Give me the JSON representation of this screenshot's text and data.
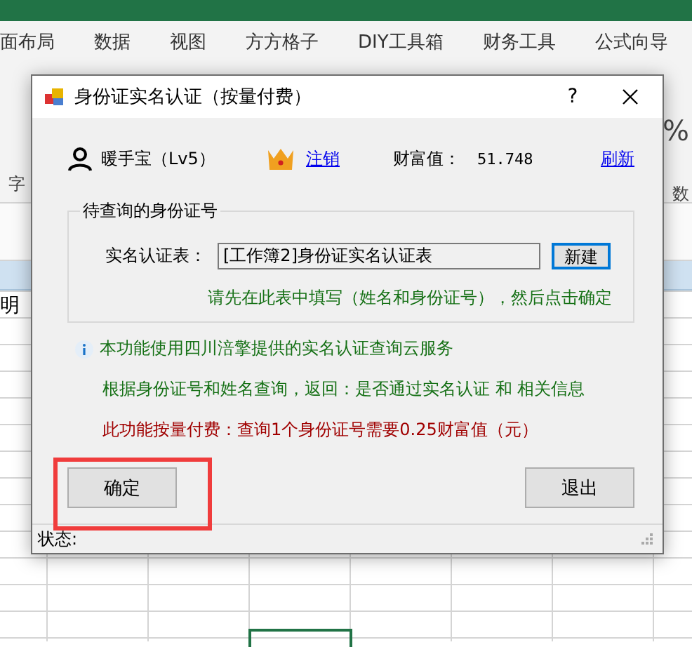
{
  "ribbon": {
    "tabs": [
      "面布局",
      "数据",
      "视图",
      "方方格子",
      "DIY工具箱",
      "财务工具",
      "公式向导"
    ],
    "left_label": "字",
    "right_label": "数",
    "percent": "%"
  },
  "sheet": {
    "cell_text": "明"
  },
  "dialog": {
    "title": "身份证实名认证（按量付费）",
    "help": "?",
    "user": {
      "name": "暖手宝（Lv5）",
      "logout_link": "注销",
      "wealth_label": "财富值：",
      "wealth_value": "51.748",
      "refresh_link": "刷新"
    },
    "group": {
      "title": "待查询的身份证号",
      "field_label": "实名认证表：",
      "field_value": "[工作簿2]身份证实名认证表",
      "new_button": "新建",
      "hint": "请先在此表中填写（姓名和身份证号），然后点击确定"
    },
    "notes": [
      {
        "kind": "info",
        "text": "本功能使用四川涪擎提供的实名认证查询云服务"
      },
      {
        "kind": "note",
        "text": "根据身份证号和姓名查询，返回：是否通过实名认证 和 相关信息"
      },
      {
        "kind": "price",
        "text": "此功能按量付费：查询1个身份证号需要0.25财富值（元）"
      }
    ],
    "ok_button": {
      "label": "确定",
      "highlighted": true
    },
    "exit_button": {
      "label": "退出"
    },
    "status": "状态:"
  }
}
